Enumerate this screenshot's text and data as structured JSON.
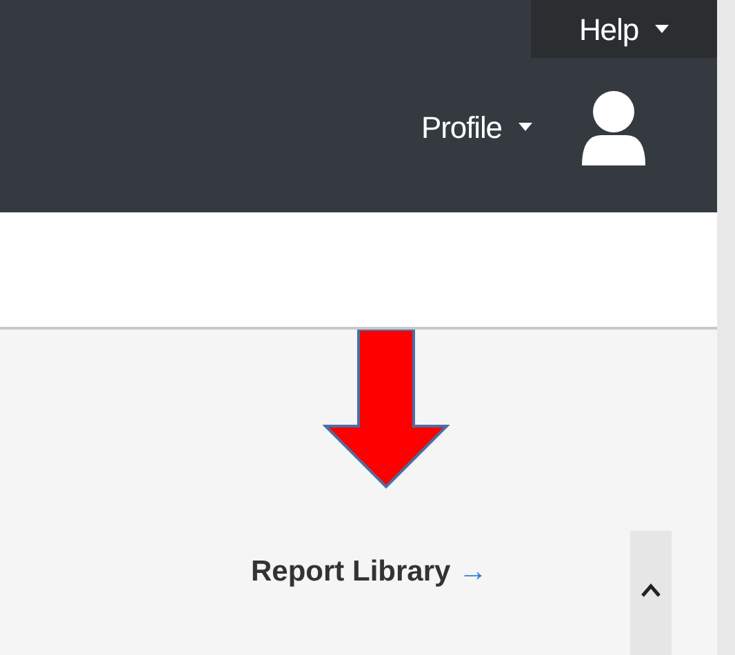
{
  "top_bar": {
    "help_menu": {
      "label": "Help"
    },
    "profile_menu": {
      "label": "Profile"
    }
  },
  "content": {
    "report_link": {
      "label": "Report Library",
      "arrow": "→"
    }
  }
}
